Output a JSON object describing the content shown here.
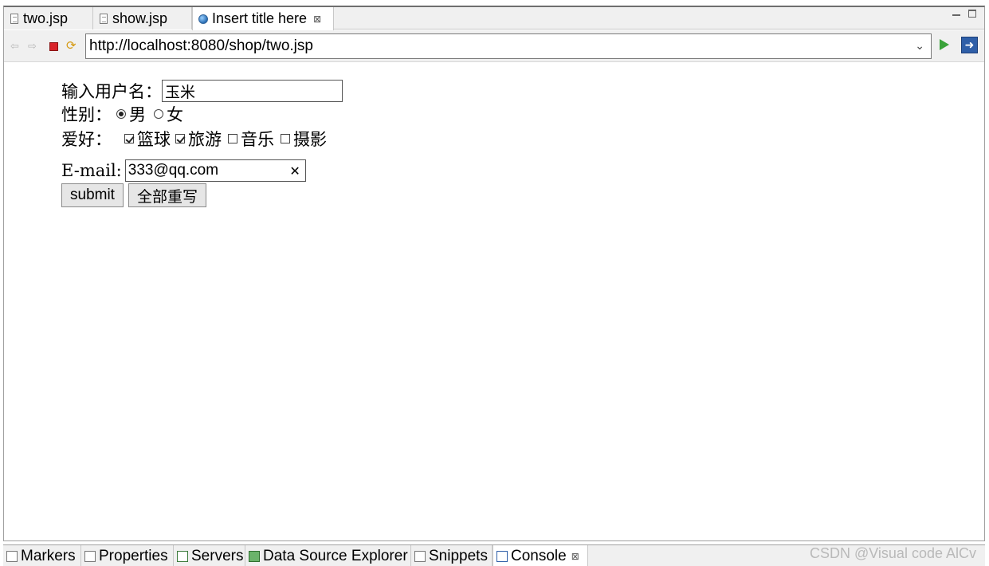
{
  "editor_tabs": [
    {
      "label": "two.jsp",
      "icon": "jsp-file-icon"
    },
    {
      "label": "show.jsp",
      "icon": "jsp-file-icon"
    },
    {
      "label": "Insert title here",
      "icon": "globe-icon",
      "active": true,
      "close": "⊠"
    }
  ],
  "navigation": {
    "url": "http://localhost:8080/shop/two.jsp"
  },
  "form": {
    "username_label": "输入用户名：",
    "username_value": "玉米",
    "gender_label": "性别：",
    "gender_options": [
      {
        "label": "男",
        "checked": true
      },
      {
        "label": "女",
        "checked": false
      }
    ],
    "hobby_label": "爱好：",
    "hobby_options": [
      {
        "label": "篮球",
        "checked": true
      },
      {
        "label": "旅游",
        "checked": true
      },
      {
        "label": "音乐",
        "checked": false
      },
      {
        "label": "摄影",
        "checked": false
      }
    ],
    "email_label": "E-mail:",
    "email_value": "333@qq.com",
    "submit_label": "submit",
    "reset_label": "全部重写"
  },
  "bottom_tabs": [
    {
      "label": "Markers"
    },
    {
      "label": "Properties"
    },
    {
      "label": "Servers"
    },
    {
      "label": "Data Source Explorer"
    },
    {
      "label": "Snippets"
    },
    {
      "label": "Console",
      "active": true,
      "close": "⊠"
    }
  ],
  "watermark": "CSDN @Visual code AlCv"
}
